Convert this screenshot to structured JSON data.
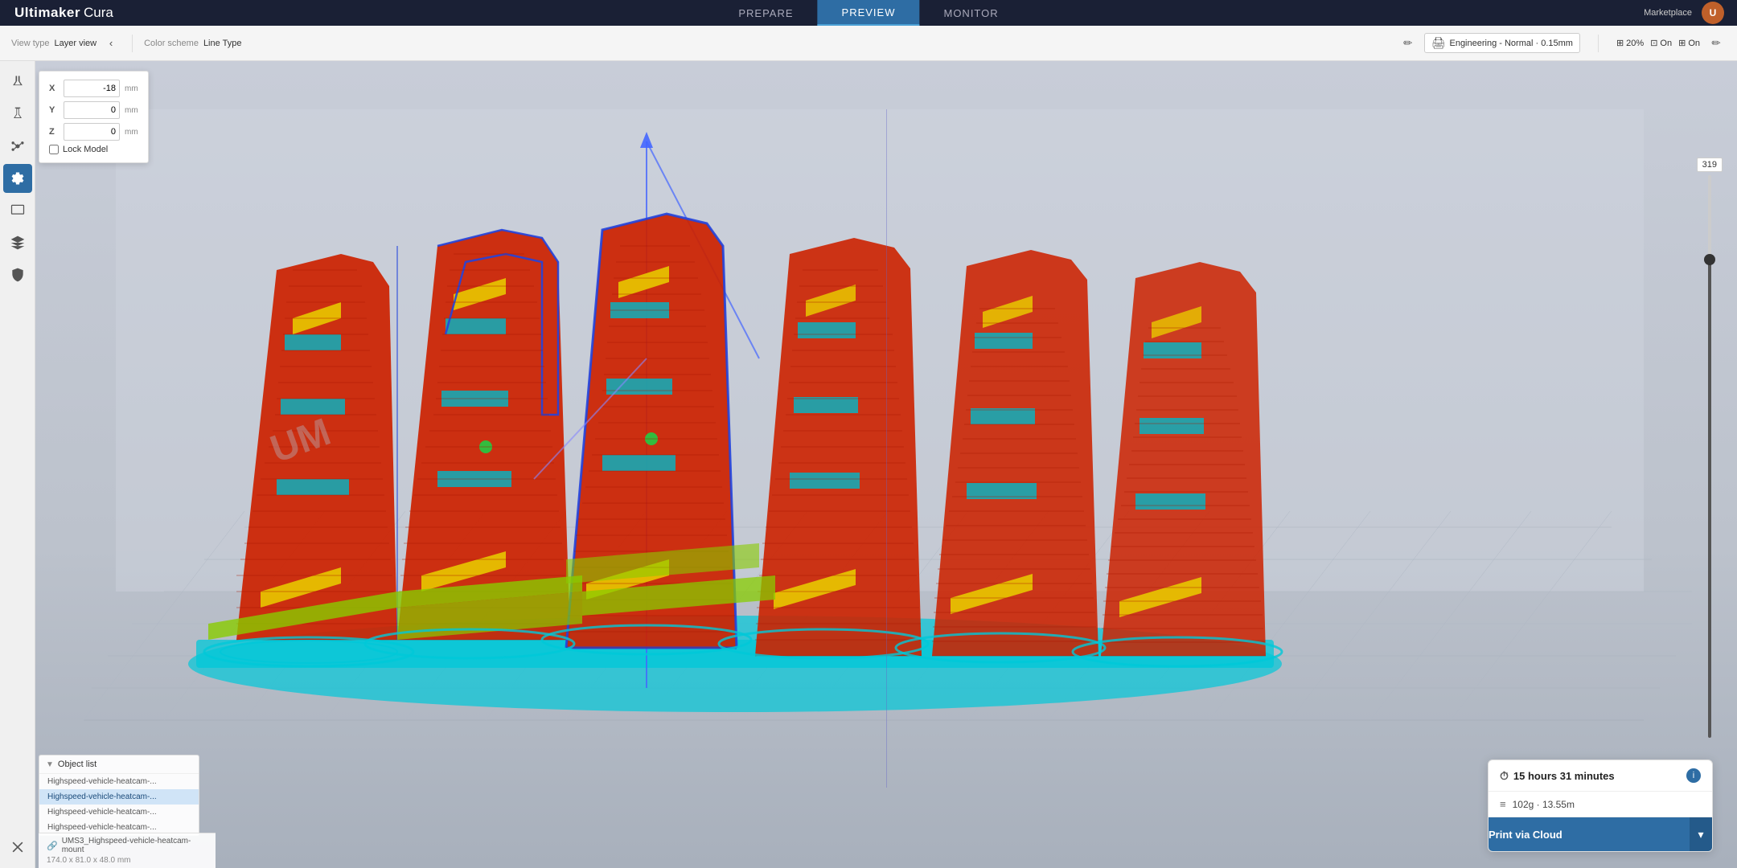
{
  "app": {
    "logo_ultimaker": "Ultimaker",
    "logo_cura": "Cura"
  },
  "nav": {
    "tabs": [
      "PREPARE",
      "PREVIEW",
      "MONITOR"
    ],
    "active_tab": "PREVIEW",
    "marketplace": "Marketplace"
  },
  "toolbar": {
    "view_type_label": "View type",
    "view_type_value": "Layer view",
    "color_scheme_label": "Color scheme",
    "color_scheme_value": "Line Type",
    "printer_name": "Engineering - Normal · 0.15mm",
    "zoom_label": "20%",
    "fan_label_1": "On",
    "fan_label_2": "On"
  },
  "transform": {
    "x_label": "X",
    "x_value": "-18",
    "x_unit": "mm",
    "y_label": "Y",
    "y_value": "0",
    "y_unit": "mm",
    "z_label": "Z",
    "z_value": "0",
    "z_unit": "mm",
    "lock_label": "Lock Model"
  },
  "layer_slider": {
    "value": "319"
  },
  "object_list": {
    "header": "Object list",
    "items": [
      "Highspeed-vehicle-heatcam-...",
      "Highspeed-vehicle-heatcam-...",
      "Highspeed-vehicle-heatcam-...",
      "Highspeed-vehicle-heatcam-..."
    ],
    "selected_index": 1
  },
  "model_info": {
    "name": "UMS3_Highspeed-vehicle-heatcam-mount",
    "dimensions": "174.0 x 81.0 x 48.0 mm"
  },
  "print_info": {
    "time": "15 hours 31 minutes",
    "material_weight": "102g · 13.55m",
    "print_button": "Print via Cloud",
    "chevron": "▾"
  },
  "sidebar_icons": [
    {
      "name": "materials-icon",
      "label": "Materials"
    },
    {
      "name": "supports-icon",
      "label": "Supports"
    },
    {
      "name": "adhesion-icon",
      "label": "Adhesion"
    },
    {
      "name": "settings-icon",
      "label": "Settings"
    },
    {
      "name": "monitor-icon",
      "label": "Monitor"
    },
    {
      "name": "layers-icon",
      "label": "Layers"
    },
    {
      "name": "shield-icon",
      "label": "Shield"
    },
    {
      "name": "close-icon",
      "label": "Close"
    }
  ]
}
